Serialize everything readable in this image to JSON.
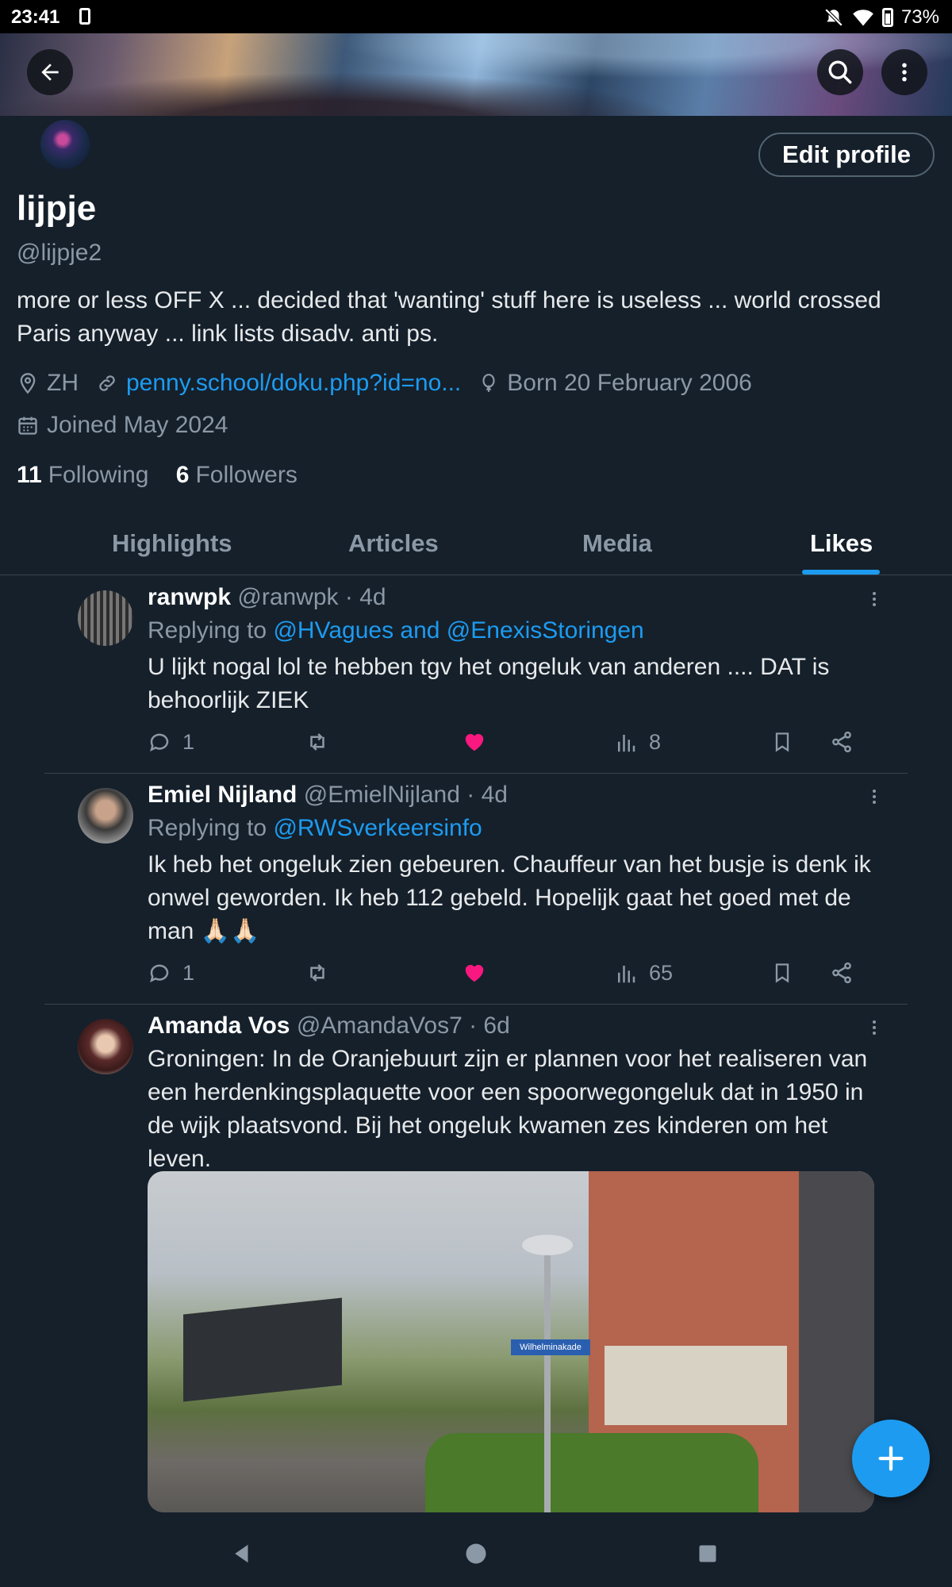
{
  "status_bar": {
    "time": "23:41",
    "battery": "73%"
  },
  "profile": {
    "edit_button": "Edit profile",
    "display_name": "lijpje",
    "handle": "@lijpje2",
    "bio": "more or less OFF X ... decided that 'wanting' stuff here is useless ... world crossed Paris anyway ... link lists disadv. anti ps.",
    "location": "ZH",
    "website": "penny.school/doku.php?id=no...",
    "birthday": "Born 20 February 2006",
    "joined": "Joined May 2024",
    "following_count": "11",
    "following_label": "Following",
    "followers_count": "6",
    "followers_label": "Followers"
  },
  "tabs": [
    {
      "label": "Highlights"
    },
    {
      "label": "Articles"
    },
    {
      "label": "Media"
    },
    {
      "label": "Likes",
      "active": true
    }
  ],
  "tweets": [
    {
      "name": "ranwpk",
      "handle": "@ranwpk",
      "time": "· 4d",
      "replying_prefix": "Replying to",
      "replying_to": "@HVagues and @EnexisStoringen",
      "text": "U lijkt nogal lol te hebben tgv het ongeluk van anderen .... DAT is behoorlijk ZIEK",
      "replies": "1",
      "views": "8"
    },
    {
      "name": "Emiel Nijland",
      "handle": "@EmielNijland",
      "time": "· 4d",
      "replying_prefix": "Replying to",
      "replying_to": "@RWSverkeersinfo",
      "text": "Ik heb het ongeluk zien gebeuren. Chauffeur van het busje is denk ik onwel geworden. Ik heb 112 gebeld. Hopelijk gaat het goed met de man 🙏🏻🙏🏻",
      "replies": "1",
      "views": "65"
    },
    {
      "name": "Amanda Vos",
      "handle": "@AmandaVos7",
      "time": "· 6d",
      "text": "Groningen: In de Oranjebuurt zijn er plannen voor het realiseren van een  herdenkingsplaquette voor een spoorwegongeluk dat in 1950 in de wijk  plaatsvond. Bij het ongeluk kwamen zes kinderen om het leven.",
      "photo_sign": "Wilhelminakade"
    }
  ],
  "colors": {
    "accent": "#1d9bf0",
    "like": "#f91880",
    "background": "#15202b",
    "muted": "#8b98a5"
  },
  "icons": [
    "back-arrow-icon",
    "search-icon",
    "more-vertical-icon",
    "location-pin-icon",
    "link-icon",
    "balloon-icon",
    "calendar-icon",
    "reply-icon",
    "retweet-icon",
    "heart-filled-icon",
    "views-icon",
    "bookmark-icon",
    "share-icon",
    "plus-icon"
  ]
}
